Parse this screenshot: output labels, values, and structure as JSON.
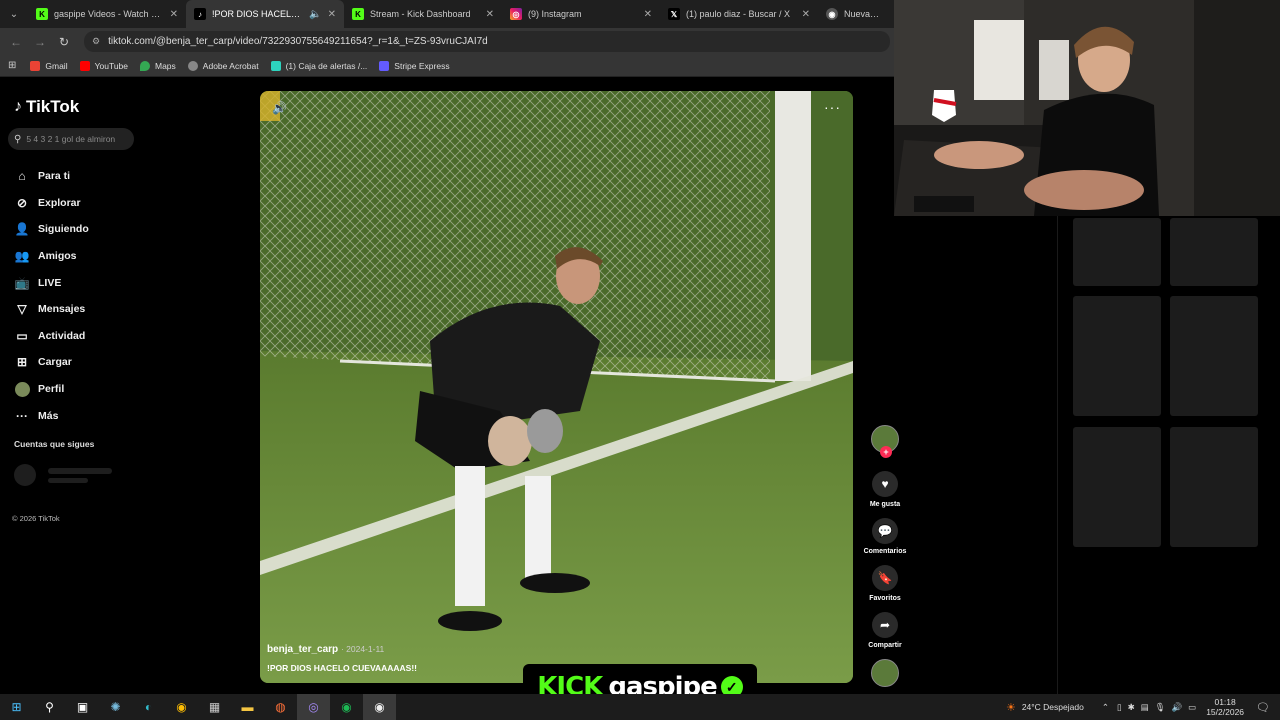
{
  "browser": {
    "tabs": [
      {
        "label": "gaspipe Videos - Watch On-De",
        "icon": "kick-icon",
        "active": false
      },
      {
        "label": "!POR DIOS HACELO CUEVA",
        "icon": "tiktok-icon",
        "active": true
      },
      {
        "label": "Stream - Kick Dashboard",
        "icon": "kick-icon",
        "active": false
      },
      {
        "label": "(9) Instagram",
        "icon": "instagram-icon",
        "active": false
      },
      {
        "label": "(1) paulo diaz - Buscar / X",
        "icon": "x-icon",
        "active": false
      },
      {
        "label": "Nueva pestaña",
        "icon": "chrome-icon",
        "active": false
      }
    ],
    "url": "tiktok.com/@benja_ter_carp/video/7322930755649211654?_r=1&_t=ZS-93vruCJAI7d",
    "bookmarks": [
      {
        "label": "Gmail",
        "color": "#ea4335"
      },
      {
        "label": "YouTube",
        "color": "#ff0000"
      },
      {
        "label": "Maps",
        "color": "#34a853"
      },
      {
        "label": "Adobe Acrobat",
        "color": "#888888"
      },
      {
        "label": "(1) Caja de alertas /...",
        "color": "#2dd4bf"
      },
      {
        "label": "Stripe Express",
        "color": "#635bff"
      }
    ]
  },
  "tiktok": {
    "logo": "TikTok",
    "search_placeholder": "5 4 3 2 1 gol de almiron",
    "nav": [
      {
        "label": "Para ti",
        "icon": "home-icon"
      },
      {
        "label": "Explorar",
        "icon": "compass-icon"
      },
      {
        "label": "Siguiendo",
        "icon": "following-icon"
      },
      {
        "label": "Amigos",
        "icon": "friends-icon"
      },
      {
        "label": "LIVE",
        "icon": "live-icon"
      },
      {
        "label": "Mensajes",
        "icon": "messages-icon"
      },
      {
        "label": "Actividad",
        "icon": "activity-icon"
      },
      {
        "label": "Cargar",
        "icon": "upload-icon"
      },
      {
        "label": "Perfil",
        "icon": "profile-avatar"
      },
      {
        "label": "Más",
        "icon": "more-icon"
      }
    ],
    "following_heading": "Cuentas que sigues",
    "copyright": "© 2026 TikTok",
    "video": {
      "username": "benja_ter_carp",
      "date": "2024-1-11",
      "caption": "!POR DIOS HACELO CUEVAAAAAS!!"
    },
    "actions": [
      {
        "label": "Me gusta",
        "icon": "heart-icon"
      },
      {
        "label": "Comentarios",
        "icon": "comment-icon"
      },
      {
        "label": "Favoritos",
        "icon": "bookmark-icon"
      },
      {
        "label": "Compartir",
        "icon": "share-icon"
      }
    ]
  },
  "overlay": {
    "kick_brand": "KICK",
    "channel": "gaspipe"
  },
  "taskbar": {
    "weather": "24°C  Despejado",
    "time": "01:18",
    "date": "15/2/2026"
  }
}
